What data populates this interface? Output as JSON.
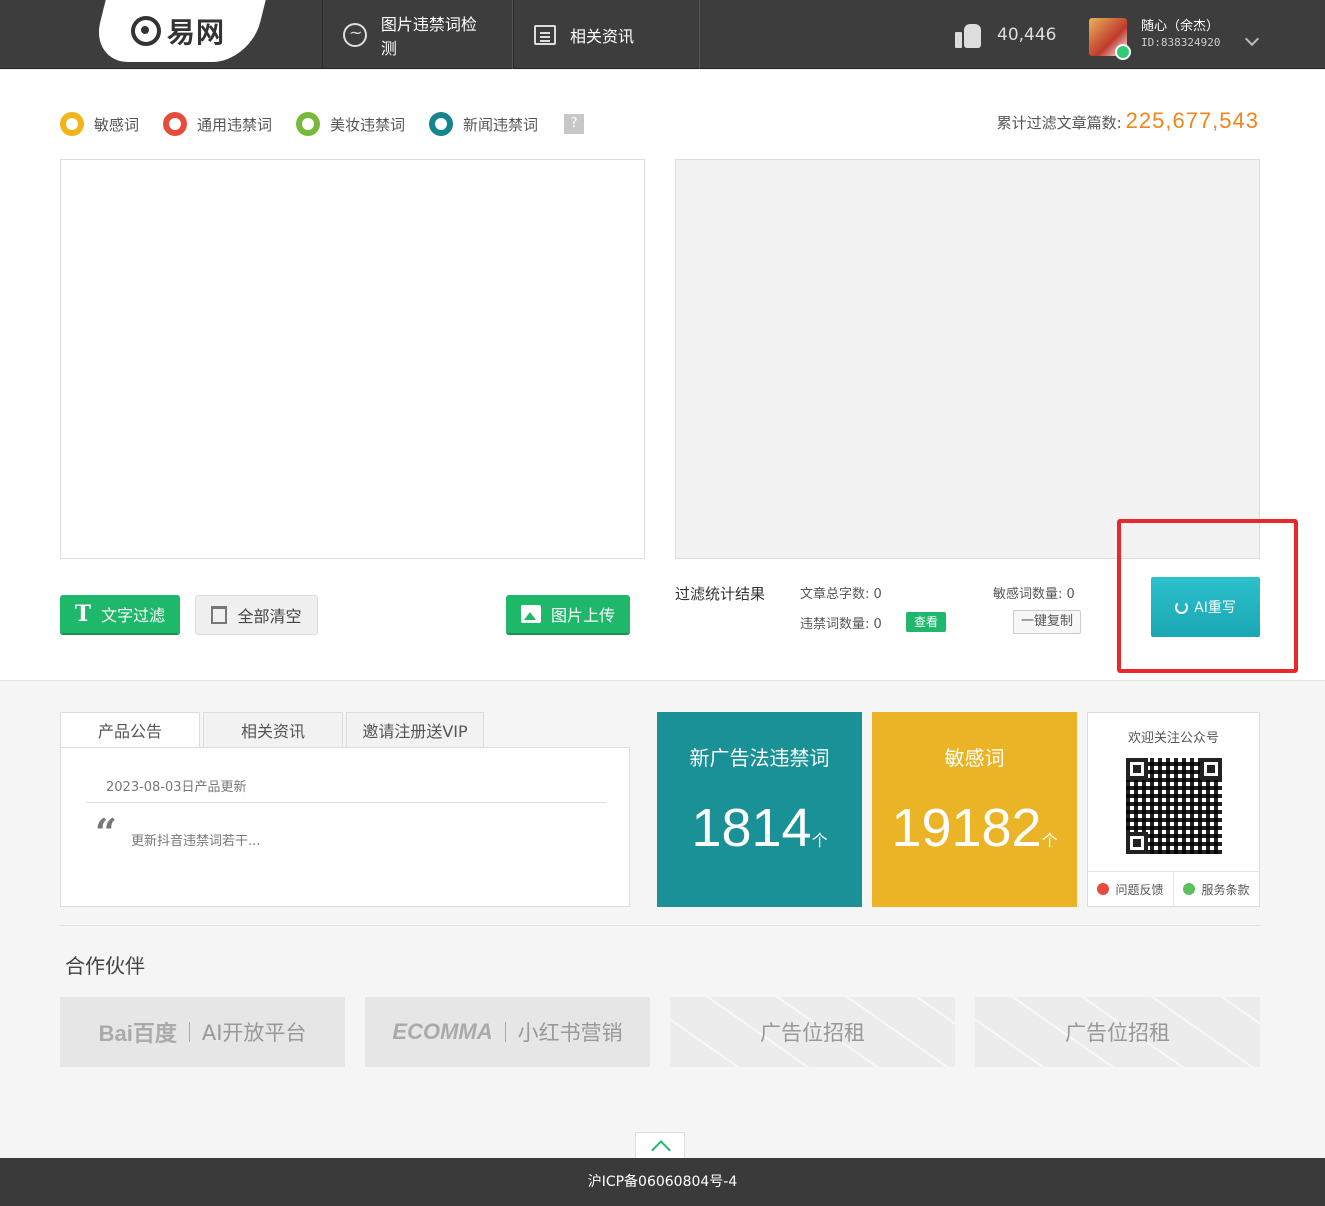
{
  "header": {
    "logo_text": "易网",
    "nav": [
      {
        "label": "图片违禁词检测",
        "icon": "image-scan-icon"
      },
      {
        "label": "相关资讯",
        "icon": "news-doc-icon"
      }
    ],
    "likes": "40,446",
    "user": {
      "name": "随心（余杰）",
      "id": "ID:838324920"
    }
  },
  "legend": [
    {
      "label": "敏感词",
      "color": "#f2b418"
    },
    {
      "label": "通用违禁词",
      "color": "#e84a3c"
    },
    {
      "label": "美妆违禁词",
      "color": "#78b93b"
    },
    {
      "label": "新闻违禁词",
      "color": "#14858f"
    }
  ],
  "help_label": "?",
  "total": {
    "label": "累计过滤文章篇数:",
    "value": "225,677,543"
  },
  "buttons": {
    "filter": "文字过滤",
    "clear": "全部清空",
    "upload": "图片上传",
    "ai_rewrite": "AI重写",
    "look": "查看",
    "copy": "一键复制"
  },
  "stats": {
    "title": "过滤统计结果",
    "total_words": "文章总字数:  0",
    "banned_count": "违禁词数量:  0",
    "sensitive_count": "敏感词数量:  0"
  },
  "tabs": [
    "产品公告",
    "相关资讯",
    "邀请注册送VIP"
  ],
  "notice": {
    "date": "2023-08-03日产品更新",
    "quote": "“",
    "text": "更新抖音违禁词若干..."
  },
  "cards": [
    {
      "title": "新广告法违禁词",
      "value": "1814",
      "unit": "个",
      "color": "#1a9196"
    },
    {
      "title": "敏感词",
      "value": "19182",
      "unit": "个",
      "color": "#ebb326"
    }
  ],
  "qr": {
    "title": "欢迎关注公众号",
    "feedback": "问题反馈",
    "terms": "服务条款"
  },
  "partners": {
    "title": "合作伙伴",
    "items": [
      {
        "brand": "Bai百度",
        "label": "AI开放平台"
      },
      {
        "brand": "ECOMMA",
        "label": "小红书营销"
      },
      {
        "brand": "",
        "label": "广告位招租"
      },
      {
        "brand": "",
        "label": "广告位招租"
      }
    ]
  },
  "footer": {
    "icp": "沪ICP备06060804号-4"
  }
}
